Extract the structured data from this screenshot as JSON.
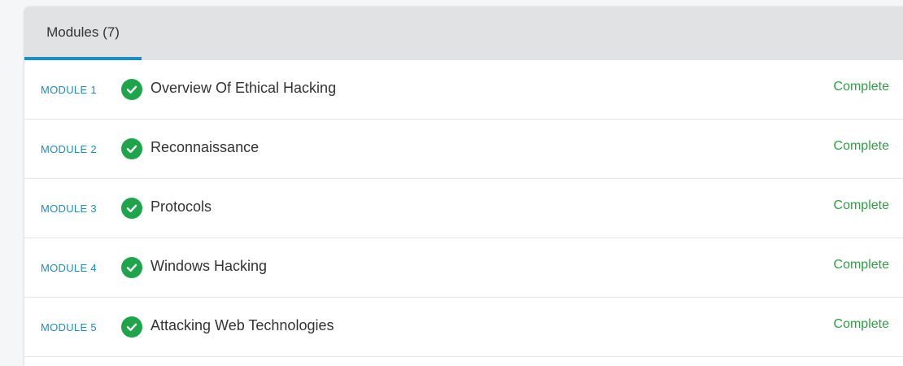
{
  "tabs": [
    {
      "label": "Modules (7)",
      "active": true
    }
  ],
  "modules": [
    {
      "number": "MODULE 1",
      "title": "Overview Of Ethical Hacking",
      "status": "Complete",
      "icon": "check-circle-icon"
    },
    {
      "number": "MODULE 2",
      "title": "Reconnaissance",
      "status": "Complete",
      "icon": "check-circle-icon"
    },
    {
      "number": "MODULE 3",
      "title": "Protocols",
      "status": "Complete",
      "icon": "check-circle-icon"
    },
    {
      "number": "MODULE 4",
      "title": "Windows Hacking",
      "status": "Complete",
      "icon": "check-circle-icon"
    },
    {
      "number": "MODULE 5",
      "title": "Attacking Web Technologies",
      "status": "Complete",
      "icon": "check-circle-icon"
    }
  ],
  "colors": {
    "accent": "#1b8ec2",
    "complete": "#2ea043",
    "check_bg": "#1ea54b",
    "tabbar_bg": "#e1e2e3"
  }
}
